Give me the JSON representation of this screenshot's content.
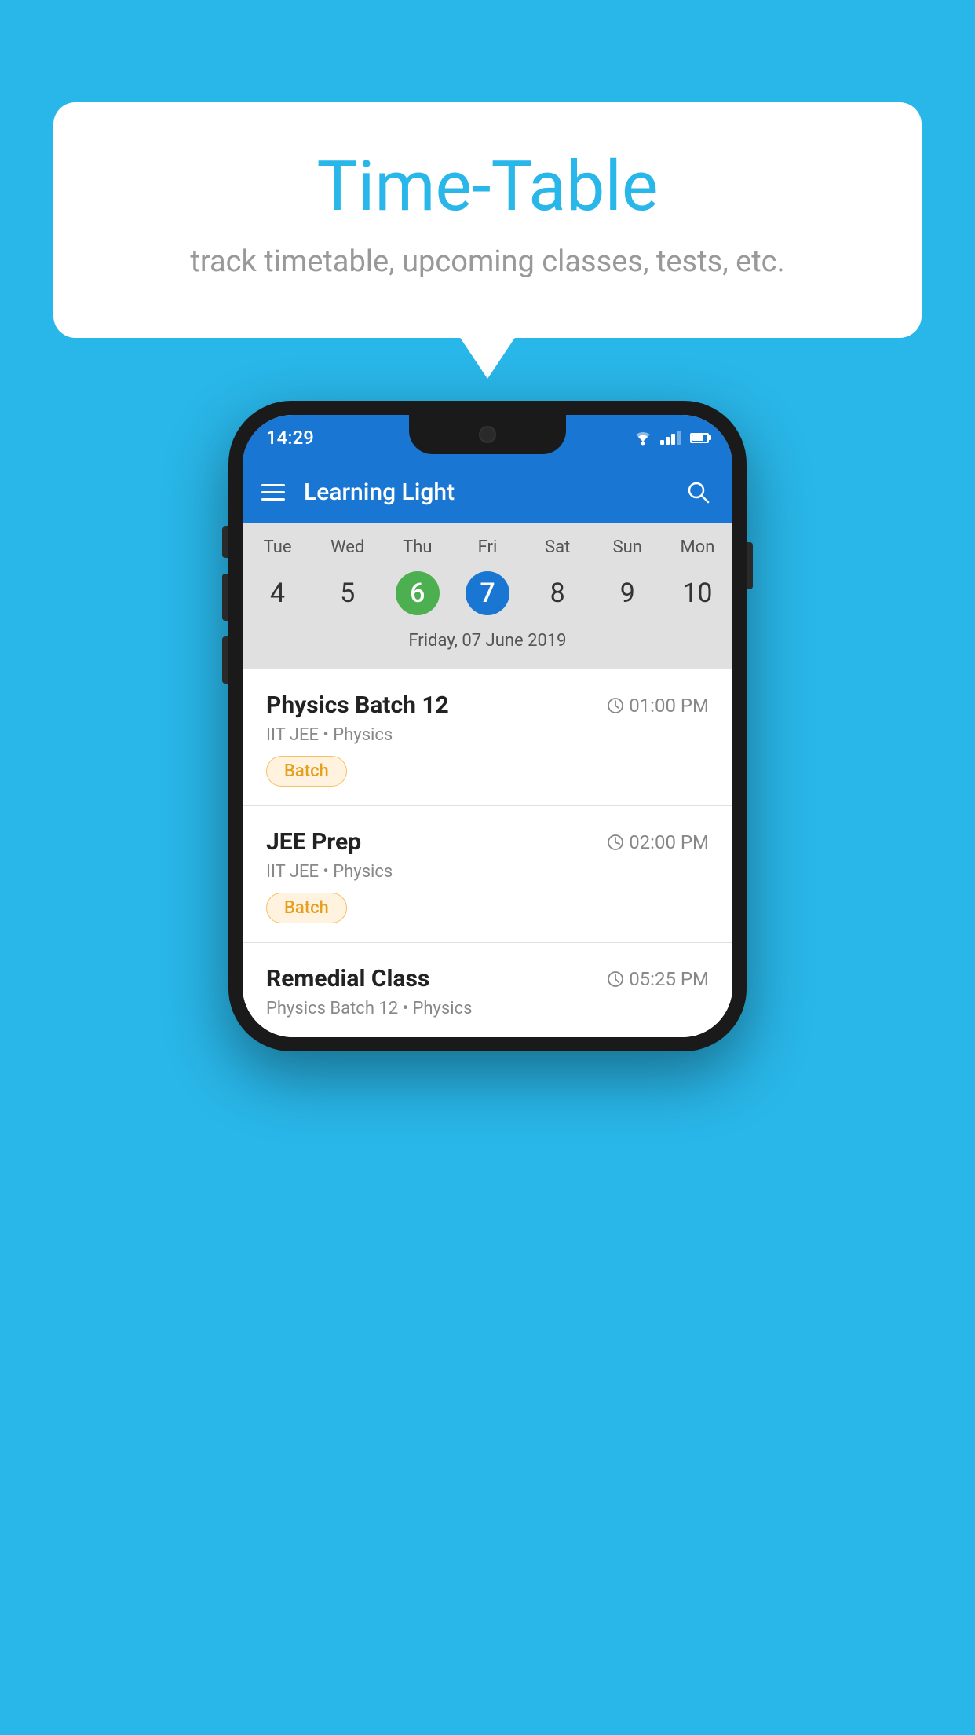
{
  "background_color": "#29B6E8",
  "speech_bubble": {
    "title": "Time-Table",
    "subtitle": "track timetable, upcoming classes, tests, etc."
  },
  "phone": {
    "status_bar": {
      "time": "14:29"
    },
    "app_bar": {
      "title": "Learning Light",
      "menu_icon": "hamburger-icon",
      "search_icon": "search-icon"
    },
    "calendar": {
      "days": [
        {
          "label": "Tue",
          "number": "4"
        },
        {
          "label": "Wed",
          "number": "5"
        },
        {
          "label": "Thu",
          "number": "6",
          "state": "today"
        },
        {
          "label": "Fri",
          "number": "7",
          "state": "selected"
        },
        {
          "label": "Sat",
          "number": "8"
        },
        {
          "label": "Sun",
          "number": "9"
        },
        {
          "label": "Mon",
          "number": "10"
        }
      ],
      "selected_date_label": "Friday, 07 June 2019"
    },
    "schedule": [
      {
        "title": "Physics Batch 12",
        "time": "01:00 PM",
        "sub": "IIT JEE • Physics",
        "badge": "Batch"
      },
      {
        "title": "JEE Prep",
        "time": "02:00 PM",
        "sub": "IIT JEE • Physics",
        "badge": "Batch"
      },
      {
        "title": "Remedial Class",
        "time": "05:25 PM",
        "sub": "Physics Batch 12 • Physics",
        "badge": null
      }
    ]
  }
}
